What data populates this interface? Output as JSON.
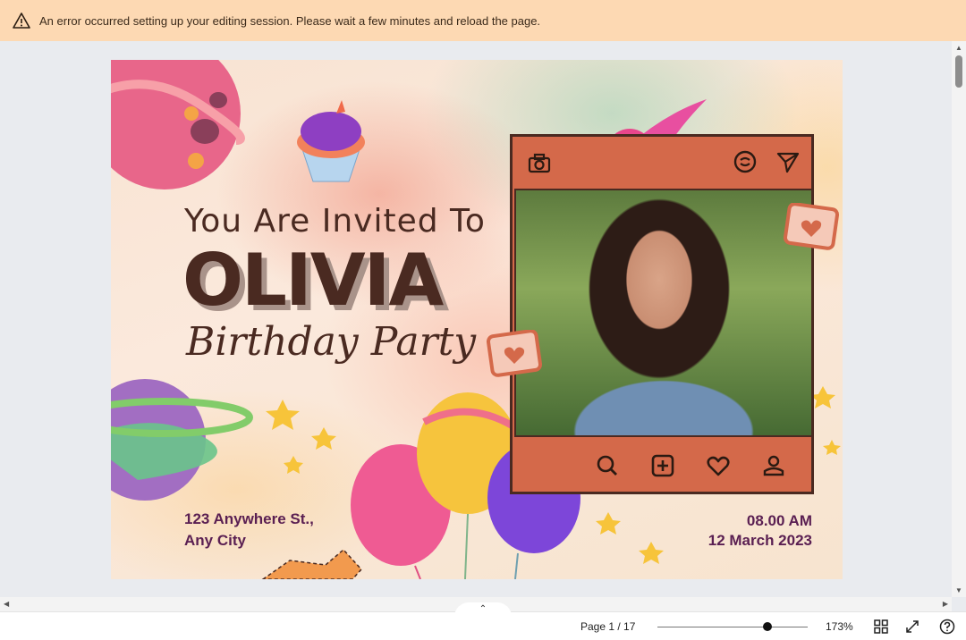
{
  "banner": {
    "message": "An error occurred setting up your editing session. Please wait a few minutes and reload the page.",
    "icon": "warning-icon",
    "bg_color": "#fdd9b3"
  },
  "invitation": {
    "line1": "You Are Invited To",
    "name": "OLIVIA",
    "event": "Birthday Party",
    "address_line1": "123 Anywhere St.,",
    "address_line2": "Any City",
    "time": "08.00 AM",
    "date": "12 March 2023",
    "text_color": "#4a2a21",
    "detail_color": "#5a1f52",
    "frame_color": "#d4694a"
  },
  "frame_icons": [
    "camera-icon",
    "reels-icon",
    "send-icon",
    "search-icon",
    "add-icon",
    "heart-icon",
    "profile-icon"
  ],
  "bottom_bar": {
    "page_indicator": "Page 1 / 17",
    "zoom_label": "173%",
    "zoom_level_fraction": 0.7,
    "icons": [
      "grid-view-icon",
      "fullscreen-icon",
      "help-icon"
    ]
  }
}
